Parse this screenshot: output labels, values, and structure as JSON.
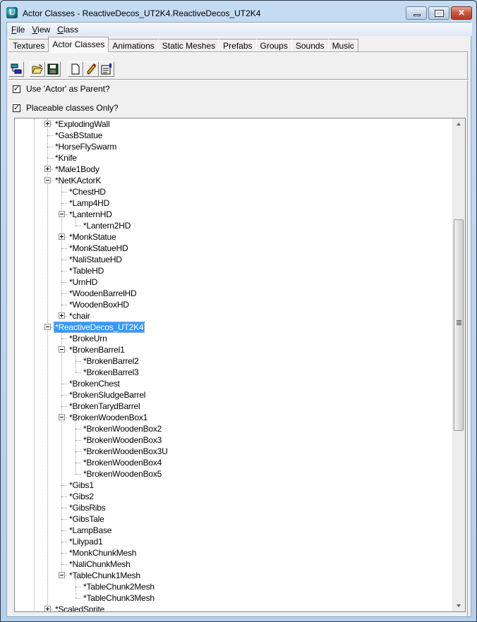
{
  "window": {
    "title": "Actor Classes - ReactiveDecos_UT2K4.ReactiveDecos_UT2K4",
    "app_icon_glyph": "U",
    "controls": [
      "minimize",
      "maximize",
      "close"
    ]
  },
  "menu": [
    {
      "label": "File",
      "accel": "F",
      "rest": "ile"
    },
    {
      "label": "View",
      "accel": "V",
      "rest": "iew"
    },
    {
      "label": "Class",
      "accel": "C",
      "rest": "lass"
    }
  ],
  "tabs": [
    {
      "label": "Textures",
      "active": false
    },
    {
      "label": "Actor Classes",
      "active": true
    },
    {
      "label": "Animations",
      "active": false
    },
    {
      "label": "Static Meshes",
      "active": false
    },
    {
      "label": "Prefabs",
      "active": false
    },
    {
      "label": "Groups",
      "active": false
    },
    {
      "label": "Sounds",
      "active": false
    },
    {
      "label": "Music",
      "active": false
    }
  ],
  "toolbar": [
    {
      "icon": "class-tree-icon",
      "tooltip": ""
    },
    {
      "icon": "open-folder-icon",
      "tooltip": ""
    },
    {
      "icon": "save-icon",
      "tooltip": ""
    },
    {
      "icon": "new-document-icon",
      "tooltip": ""
    },
    {
      "icon": "edit-pencil-icon",
      "tooltip": ""
    },
    {
      "icon": "properties-icon",
      "tooltip": ""
    }
  ],
  "options": {
    "use_actor_parent": {
      "label": "Use 'Actor' as Parent?",
      "checked": true
    },
    "placeable_only": {
      "label": "Placeable classes Only?",
      "checked": true
    }
  },
  "tree": {
    "selected": "*ReactiveDecos_UT2K4",
    "rows": [
      {
        "label": "*ExplodingWall",
        "level": 0,
        "expander": "plus"
      },
      {
        "label": "*GasBStatue",
        "level": 0,
        "expander": null
      },
      {
        "label": "*HorseFlySwarm",
        "level": 0,
        "expander": null
      },
      {
        "label": "*Knife",
        "level": 0,
        "expander": null
      },
      {
        "label": "*Male1Body",
        "level": 0,
        "expander": "plus"
      },
      {
        "label": "*NetKActorK",
        "level": 0,
        "expander": "minus"
      },
      {
        "label": "*ChestHD",
        "level": 1,
        "expander": null
      },
      {
        "label": "*Lamp4HD",
        "level": 1,
        "expander": null
      },
      {
        "label": "*LanternHD",
        "level": 1,
        "expander": "minus"
      },
      {
        "label": "*Lantern2HD",
        "level": 2,
        "expander": null
      },
      {
        "label": "*MonkStatue",
        "level": 1,
        "expander": "plus"
      },
      {
        "label": "*MonkStatueHD",
        "level": 1,
        "expander": null
      },
      {
        "label": "*NaliStatueHD",
        "level": 1,
        "expander": null
      },
      {
        "label": "*TableHD",
        "level": 1,
        "expander": null
      },
      {
        "label": "*UrnHD",
        "level": 1,
        "expander": null
      },
      {
        "label": "*WoodenBarrelHD",
        "level": 1,
        "expander": null
      },
      {
        "label": "*WoodenBoxHD",
        "level": 1,
        "expander": null
      },
      {
        "label": "*chair",
        "level": 1,
        "expander": "plus"
      },
      {
        "label": "*ReactiveDecos_UT2K4",
        "level": 0,
        "expander": "minus",
        "selected": true
      },
      {
        "label": "*BrokeUrn",
        "level": 1,
        "expander": null
      },
      {
        "label": "*BrokenBarrel1",
        "level": 1,
        "expander": "minus"
      },
      {
        "label": "*BrokenBarrel2",
        "level": 2,
        "expander": null
      },
      {
        "label": "*BrokenBarrel3",
        "level": 2,
        "expander": null
      },
      {
        "label": "*BrokenChest",
        "level": 1,
        "expander": null
      },
      {
        "label": "*BrokenSludgeBarrel",
        "level": 1,
        "expander": null
      },
      {
        "label": "*BrokenTarydBarrel",
        "level": 1,
        "expander": null
      },
      {
        "label": "*BrokenWoodenBox1",
        "level": 1,
        "expander": "minus"
      },
      {
        "label": "*BrokenWoodenBox2",
        "level": 2,
        "expander": null
      },
      {
        "label": "*BrokenWoodenBox3",
        "level": 2,
        "expander": null
      },
      {
        "label": "*BrokenWoodenBox3U",
        "level": 2,
        "expander": null
      },
      {
        "label": "*BrokenWoodenBox4",
        "level": 2,
        "expander": null
      },
      {
        "label": "*BrokenWoodenBox5",
        "level": 2,
        "expander": null
      },
      {
        "label": "*Gibs1",
        "level": 1,
        "expander": null
      },
      {
        "label": "*Gibs2",
        "level": 1,
        "expander": null
      },
      {
        "label": "*GibsRibs",
        "level": 1,
        "expander": null
      },
      {
        "label": "*GibsTale",
        "level": 1,
        "expander": null
      },
      {
        "label": "*LampBase",
        "level": 1,
        "expander": null
      },
      {
        "label": "*Lilypad1",
        "level": 1,
        "expander": null
      },
      {
        "label": "*MonkChunkMesh",
        "level": 1,
        "expander": null
      },
      {
        "label": "*NaliChunkMesh",
        "level": 1,
        "expander": null
      },
      {
        "label": "*TableChunk1Mesh",
        "level": 1,
        "expander": "minus"
      },
      {
        "label": "*TableChunk2Mesh",
        "level": 2,
        "expander": null
      },
      {
        "label": "*TableChunk3Mesh",
        "level": 2,
        "expander": null
      },
      {
        "label": "*ScaledSprite",
        "level": 0,
        "expander": "plus"
      }
    ]
  },
  "scrollbar": {
    "position_fraction": 0.19,
    "visible_fraction": 0.45
  }
}
